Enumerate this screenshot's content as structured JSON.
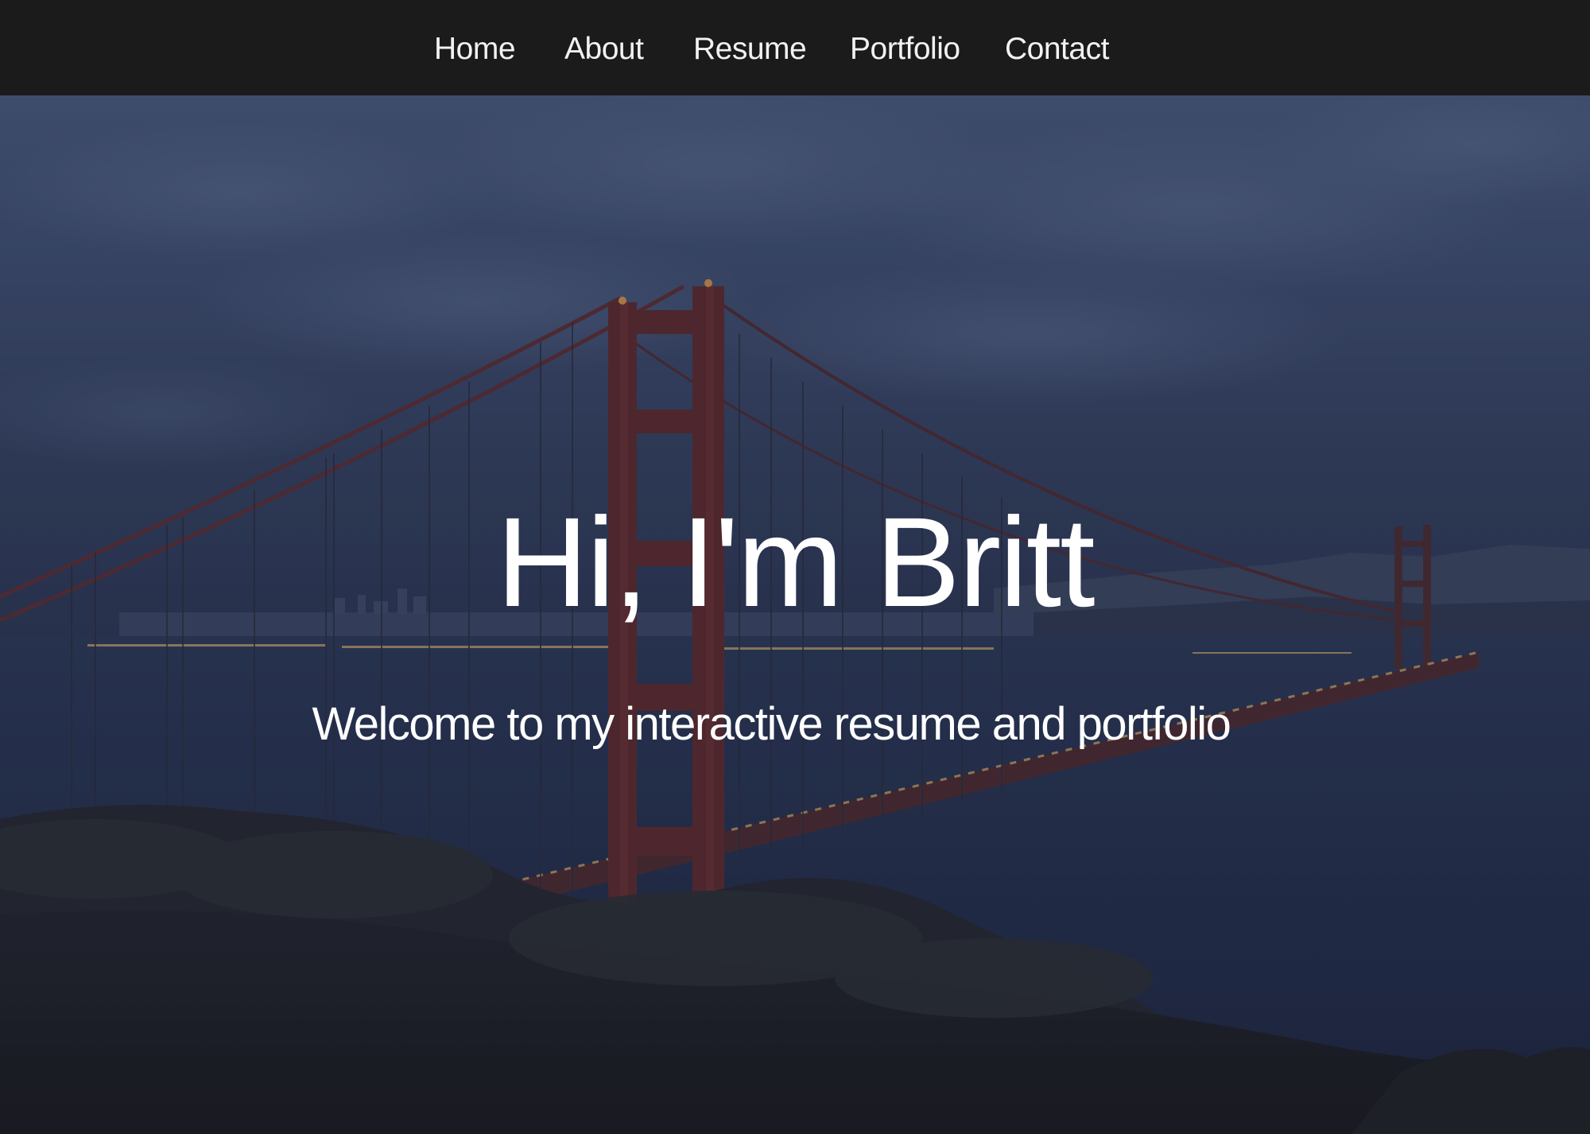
{
  "nav": {
    "items": [
      {
        "label": "Home"
      },
      {
        "label": "About"
      },
      {
        "label": "Resume"
      },
      {
        "label": "Portfolio"
      },
      {
        "label": "Contact"
      }
    ]
  },
  "hero": {
    "title": "Hi, I'm Britt",
    "subtitle": "Welcome to my interactive resume and portfolio"
  },
  "colors": {
    "navbar": "#1b1b1b",
    "nav_text": "#f2f2f2",
    "hero_text": "#ffffff"
  }
}
